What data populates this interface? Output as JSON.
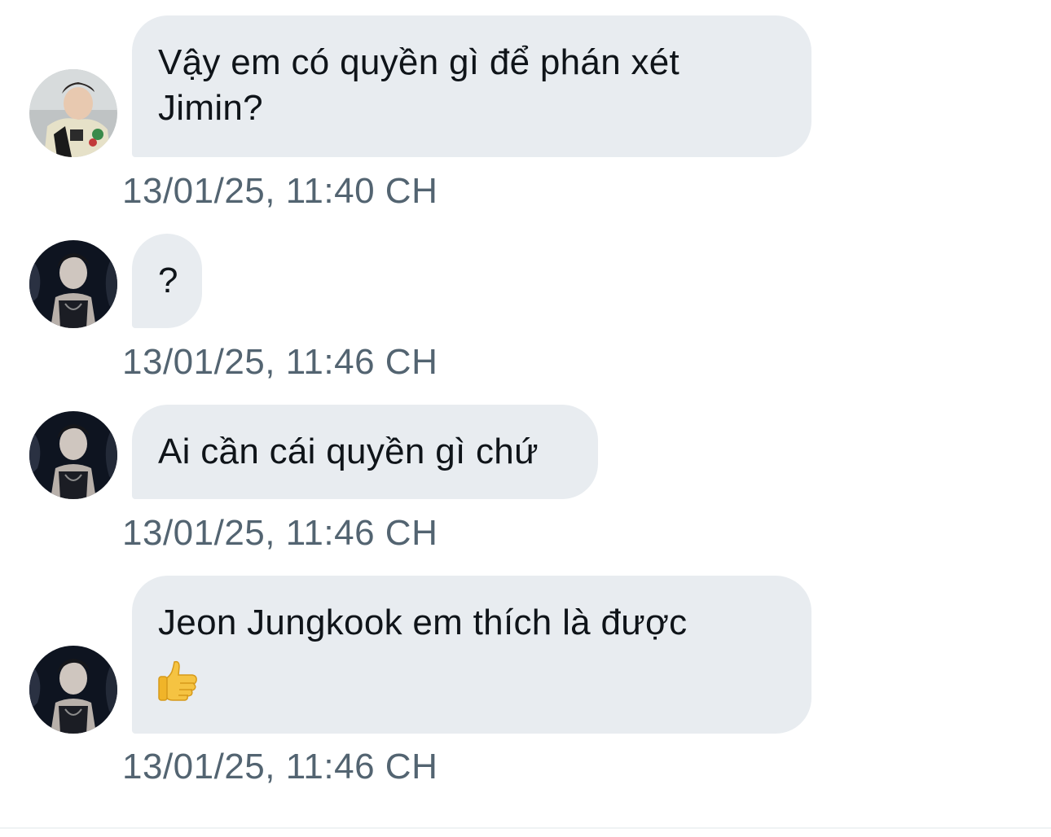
{
  "messages": [
    {
      "sender": "left-user-1",
      "lines": [
        "Vậy em có quyền gì để phán xét",
        "Jimin?"
      ],
      "timestamp": "13/01/25, 11:40 CH"
    },
    {
      "sender": "left-user-2",
      "lines": [
        "?"
      ],
      "timestamp": "13/01/25, 11:46 CH"
    },
    {
      "sender": "left-user-2",
      "lines": [
        "Ai cần cái quyền gì chứ"
      ],
      "timestamp": "13/01/25, 11:46 CH"
    },
    {
      "sender": "left-user-2",
      "lines": [
        "Jeon Jungkook em thích là được"
      ],
      "emoji": "thumbs-up-icon",
      "timestamp": "13/01/25, 11:46 CH"
    }
  ],
  "colors": {
    "bubble_bg": "#e8ecf0",
    "text": "#0f1419",
    "timestamp": "#536471",
    "divider": "#eff3f4"
  }
}
